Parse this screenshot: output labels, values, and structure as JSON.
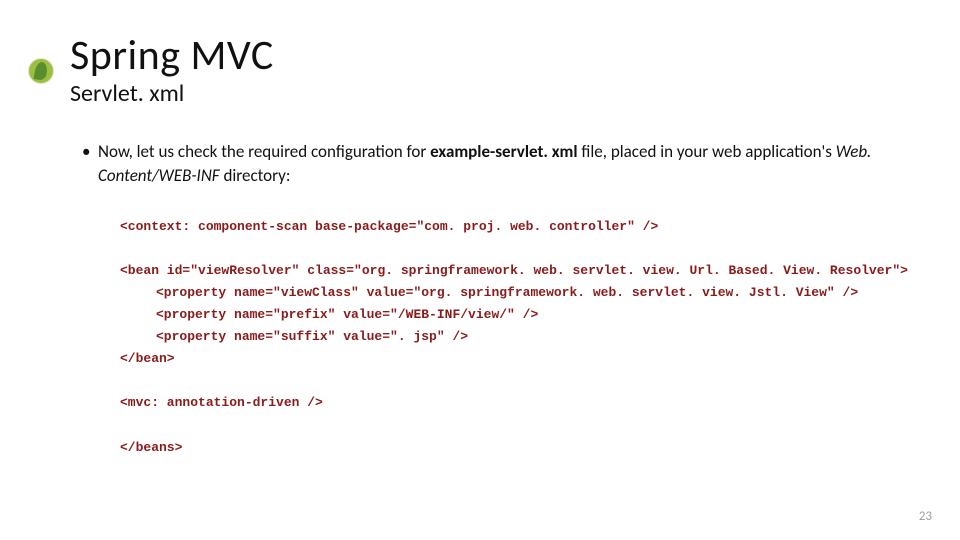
{
  "header": {
    "title": "Spring MVC",
    "subtitle": "Servlet. xml"
  },
  "bullet": {
    "lead": "Now, let us check the required configuration for ",
    "bold": "example-servlet. xml",
    "mid": " file, placed in your web application's ",
    "ital": "Web. Content/WEB-INF",
    "tail": " directory:"
  },
  "code": {
    "l1": "<context: component-scan base-package=\"com. proj. web. controller\" />",
    "l2": "<bean id=\"viewResolver\" class=\"org. springframework. web. servlet. view. Url. Based. View. Resolver\">",
    "l3": "<property name=\"viewClass\" value=\"org. springframework. web. servlet. view. Jstl. View\" />",
    "l4": "<property name=\"prefix\" value=\"/WEB-INF/view/\" />",
    "l5": "<property name=\"suffix\" value=\". jsp\" />",
    "l6": "</bean>",
    "l7": "<mvc: annotation-driven />",
    "l8": "</beans>"
  },
  "page_number": "23"
}
